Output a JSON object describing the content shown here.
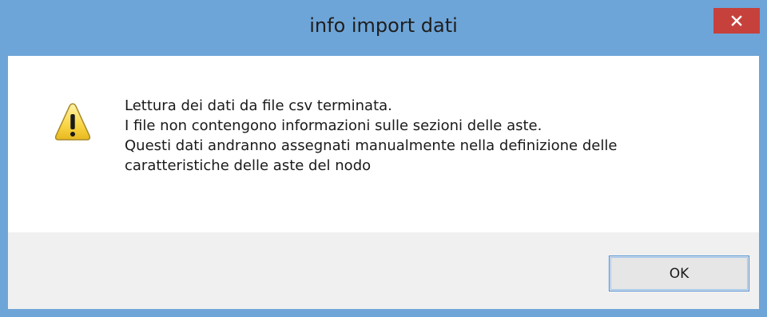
{
  "window": {
    "title": "info import dati",
    "close_icon": "close-icon"
  },
  "dialog": {
    "icon": "warning-icon",
    "message_lines": [
      "Lettura dei dati da file csv terminata.",
      "I file non contengono informazioni sulle sezioni delle aste.",
      "Questi dati andranno assegnati manualmente nella definizione delle",
      "caratteristiche delle aste del nodo"
    ],
    "ok_label": "OK"
  },
  "colors": {
    "frame": "#6ea5d8",
    "close_button": "#c7413c",
    "footer": "#f0f0f0",
    "default_button_border": "#4b8fd6"
  }
}
